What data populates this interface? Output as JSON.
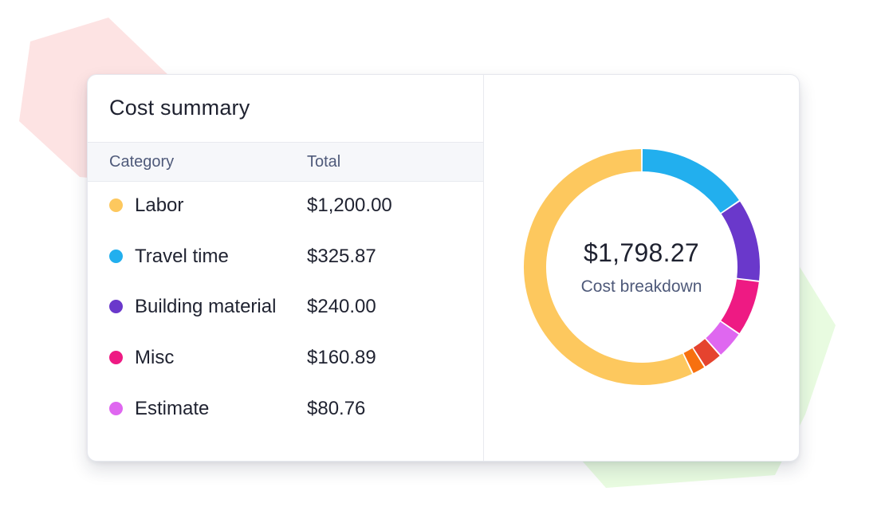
{
  "card": {
    "title": "Cost summary",
    "columns": {
      "category": "Category",
      "total": "Total"
    },
    "rows": [
      {
        "label": "Labor",
        "amount": "$1,200.00",
        "color": "#FDC85E"
      },
      {
        "label": "Travel time",
        "amount": "$325.87",
        "color": "#22AFEE"
      },
      {
        "label": "Building material",
        "amount": "$240.00",
        "color": "#6A38CB"
      },
      {
        "label": "Misc",
        "amount": "$160.89",
        "color": "#EE1A83"
      },
      {
        "label": "Estimate",
        "amount": "$80.76",
        "color": "#DF67F0"
      }
    ]
  },
  "breakdown": {
    "total": "$1,798.27",
    "label": "Cost breakdown"
  },
  "chart_data": {
    "type": "pie",
    "style": "donut",
    "start_angle_deg": 0,
    "direction": "clockwise",
    "slices": [
      {
        "name": "Travel time",
        "value": 325.87,
        "color": "#22AFEE"
      },
      {
        "name": "Building material",
        "value": 240.0,
        "color": "#6A38CB"
      },
      {
        "name": "Misc",
        "value": 160.89,
        "color": "#EE1A83"
      },
      {
        "name": "Estimate",
        "value": 80.76,
        "color": "#DF67F0"
      },
      {
        "value": 55.0,
        "color": "#E5432F"
      },
      {
        "value": 39.0,
        "color": "#F7700F"
      },
      {
        "name": "Labor",
        "value": 1200.0,
        "color": "#FDC85E"
      }
    ]
  },
  "background": {
    "shape_colors": [
      "#FDE3E3",
      "#E8FBE0"
    ]
  }
}
